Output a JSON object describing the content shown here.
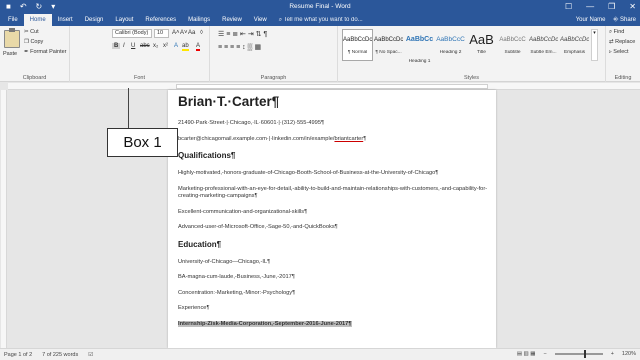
{
  "titlebar": {
    "title": "Resume Final - Word",
    "qat": [
      "■",
      "↶",
      "↻",
      "▾"
    ],
    "controls": [
      "☐",
      "—",
      "❐",
      "✕"
    ]
  },
  "tabs": [
    "File",
    "Home",
    "Insert",
    "Design",
    "Layout",
    "References",
    "Mailings",
    "Review",
    "View",
    "⌕ Tell me what you want to do..."
  ],
  "active_tab": "Home",
  "account": {
    "user": "Your Name",
    "share": "⎆ Share"
  },
  "ribbon": {
    "clipboard": {
      "paste": "Paste",
      "cut": "✂ Cut",
      "copy": "❐ Copy",
      "format_painter": "✒ Format Painter",
      "label": "Clipboard"
    },
    "font": {
      "name": "Calibri (Body)",
      "size": "10",
      "grow": "A˄",
      "shrink": "A˅",
      "case": "Aa",
      "clear": "◊",
      "bold": "B",
      "italic": "I",
      "underline": "U",
      "strike": "abc",
      "sub": "x₂",
      "sup": "x²",
      "effects": "A",
      "highlight": "ab",
      "color": "A",
      "label": "Font"
    },
    "paragraph": {
      "row1": "☰ ≡ ≣  ⇤ ⇥  ⇅  ¶",
      "row2": "≡ ≡ ≡ ≡  ↕  ▒  ▦",
      "label": "Paragraph"
    },
    "styles": [
      {
        "preview": "AaBbCcDc",
        "name": "¶ Normal",
        "kind": "normal"
      },
      {
        "preview": "AaBbCcDc",
        "name": "¶ No Spac...",
        "kind": "normal"
      },
      {
        "preview": "AaBbCc",
        "name": "Heading 1",
        "kind": "h1"
      },
      {
        "preview": "AaBbCcC",
        "name": "Heading 2",
        "kind": "h2"
      },
      {
        "preview": "AaB",
        "name": "Title",
        "kind": "ttl"
      },
      {
        "preview": "AaBbCcC",
        "name": "Subtitle",
        "kind": "sub"
      },
      {
        "preview": "AaBbCcDc",
        "name": "Subtle Em...",
        "kind": "emph"
      },
      {
        "preview": "AaBbCcDc",
        "name": "Emphasis",
        "kind": "emph"
      }
    ],
    "styles_label": "Styles",
    "editing": {
      "find": "⌕ Find",
      "replace": "⇄ Replace",
      "select": "▹ Select",
      "label": "Editing"
    }
  },
  "document": {
    "name": "Brian·T.·Carter¶",
    "address": "21490·Park·Street·|·Chicago,·IL·60601·|·(312)·555-4995¶",
    "contact_prefix": "bcarter@chicagomail.example.com·|·linkedin.com/in/example/",
    "contact_link": "briantcarter",
    "contact_end": "¶",
    "qualifications_heading": "Qualifications¶",
    "qualifications": [
      "Highly-motivated,-honors-graduate-of-Chicago-Booth-School-of-Business-at-the-University-of-Chicago¶",
      "Marketing-professional-with-an-eye-for-detail,-ability-to-build-and-maintain-relationships-with-customers,-and-capability-for-creating-marketing-campaigns¶",
      "Excellent-communication-and-organizational-skills¶",
      "Advanced-user-of-Microsoft-Office,-Sage-50,-and-QuickBooks¶"
    ],
    "education_heading": "Education¶",
    "education": [
      "University-of-Chicago—Chicago,-IL¶",
      "BA-magna-cum-laude,-Business,-June,-2017¶",
      "Concentration:-Marketing,-Minor:-Psychology¶"
    ],
    "experience_label": "Experience¶",
    "internship": "Internship-Zisk-Media-Corporation,-September-2016-June-2017¶"
  },
  "annotation": {
    "label": "Box 1"
  },
  "statusbar": {
    "page": "Page 1 of 2",
    "words": "7 of 225 words",
    "proof_icon": "☑",
    "view_icons": "▤  ▥  ▦",
    "zoom_minus": "−",
    "zoom_plus": "+",
    "zoom": "120%",
    "zoom_fraction": 0.6
  }
}
